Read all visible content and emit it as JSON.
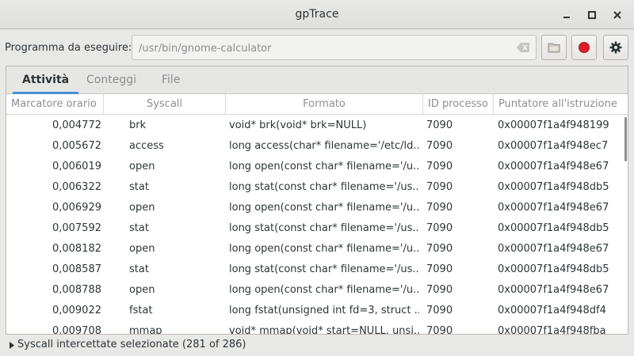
{
  "window": {
    "title": "gpTrace"
  },
  "toolbar": {
    "program_label": "Programma da eseguire:",
    "program_value": "/usr/bin/gnome-calculator"
  },
  "tabs": [
    {
      "label": "Attività",
      "active": true
    },
    {
      "label": "Conteggi",
      "active": false
    },
    {
      "label": "File",
      "active": false
    }
  ],
  "table": {
    "columns": [
      "Marcatore orario",
      "Syscall",
      "Formato",
      "ID processo",
      "Puntatore all'istruzione"
    ],
    "rows": [
      [
        "0,004772",
        "brk",
        "void* brk(void* brk=NULL)",
        "7090",
        "0x00007f1a4f948199"
      ],
      [
        "0,005672",
        "access",
        "long access(char* filename='/etc/ld...",
        "7090",
        "0x00007f1a4f948ec7"
      ],
      [
        "0,006019",
        "open",
        "long open(const char* filename='/u...",
        "7090",
        "0x00007f1a4f948e67"
      ],
      [
        "0,006322",
        "stat",
        "long stat(const char* filename='/us...",
        "7090",
        "0x00007f1a4f948db5"
      ],
      [
        "0,006929",
        "open",
        "long open(const char* filename='/u...",
        "7090",
        "0x00007f1a4f948e67"
      ],
      [
        "0,007592",
        "stat",
        "long stat(const char* filename='/us...",
        "7090",
        "0x00007f1a4f948db5"
      ],
      [
        "0,008182",
        "open",
        "long open(const char* filename='/u...",
        "7090",
        "0x00007f1a4f948e67"
      ],
      [
        "0,008587",
        "stat",
        "long stat(const char* filename='/us...",
        "7090",
        "0x00007f1a4f948db5"
      ],
      [
        "0,008788",
        "open",
        "long open(const char* filename='/u...",
        "7090",
        "0x00007f1a4f948e67"
      ],
      [
        "0,009022",
        "fstat",
        "long fstat(unsigned int fd=3, struct ...",
        "7090",
        "0x00007f1a4f948df4"
      ],
      [
        "0,009708",
        "mmap",
        "void* mmap(void* start=NULL, unsi...",
        "7090",
        "0x00007f1a4f948fba"
      ]
    ]
  },
  "expander": {
    "label": "Syscall intercettate selezionate (281 of 286)"
  },
  "colors": {
    "accent": "#4a90d9",
    "record": "#e01b24"
  }
}
